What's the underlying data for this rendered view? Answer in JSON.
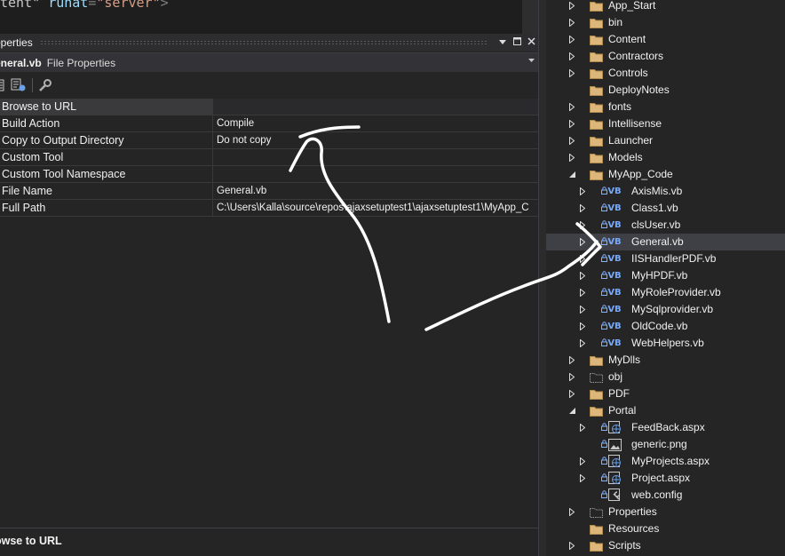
{
  "code_editor": {
    "line_parts": [
      "tent\"",
      " ",
      "runat",
      "=",
      "\"server\"",
      ">"
    ]
  },
  "properties": {
    "title": "operties",
    "object_name": "eneral.vb",
    "object_type": "File Properties",
    "rows": [
      {
        "name": "Browse to URL",
        "value": ""
      },
      {
        "name": "Build Action",
        "value": "Compile"
      },
      {
        "name": "Copy to Output Directory",
        "value": "Do not copy"
      },
      {
        "name": "Custom Tool",
        "value": ""
      },
      {
        "name": "Custom Tool Namespace",
        "value": ""
      },
      {
        "name": "File Name",
        "value": "General.vb"
      },
      {
        "name": "Full Path",
        "value": "C:\\Users\\Kalla\\source\\repos\\ajaxsetuptest1\\ajaxsetuptest1\\MyApp_C"
      }
    ],
    "description_title": "owse to URL"
  },
  "solution_explorer": {
    "items": [
      {
        "label": "App_Start",
        "level": 0,
        "icon": "folder-icon",
        "expander": "collapsed"
      },
      {
        "label": "bin",
        "level": 0,
        "icon": "folder-icon",
        "expander": "collapsed"
      },
      {
        "label": "Content",
        "level": 0,
        "icon": "folder-icon",
        "expander": "collapsed"
      },
      {
        "label": "Contractors",
        "level": 0,
        "icon": "folder-icon",
        "expander": "collapsed"
      },
      {
        "label": "Controls",
        "level": 0,
        "icon": "folder-icon",
        "expander": "collapsed"
      },
      {
        "label": "DeployNotes",
        "level": 0,
        "icon": "folder-icon",
        "expander": "none"
      },
      {
        "label": "fonts",
        "level": 0,
        "icon": "folder-icon",
        "expander": "collapsed"
      },
      {
        "label": "Intellisense",
        "level": 0,
        "icon": "folder-icon",
        "expander": "collapsed"
      },
      {
        "label": "Launcher",
        "level": 0,
        "icon": "folder-icon",
        "expander": "collapsed"
      },
      {
        "label": "Models",
        "level": 0,
        "icon": "folder-icon",
        "expander": "collapsed"
      },
      {
        "label": "MyApp_Code",
        "level": 0,
        "icon": "folder-icon",
        "expander": "expanded"
      },
      {
        "label": "AxisMis.vb",
        "level": 1,
        "icon": "vb-file-icon",
        "expander": "collapsed",
        "locked": true
      },
      {
        "label": "Class1.vb",
        "level": 1,
        "icon": "vb-file-icon",
        "expander": "collapsed",
        "locked": true
      },
      {
        "label": "clsUser.vb",
        "level": 1,
        "icon": "vb-file-icon",
        "expander": "collapsed",
        "locked": true
      },
      {
        "label": "General.vb",
        "level": 1,
        "icon": "vb-file-icon",
        "expander": "collapsed",
        "locked": true,
        "selected": true
      },
      {
        "label": "IISHandlerPDF.vb",
        "level": 1,
        "icon": "vb-file-icon",
        "expander": "collapsed",
        "locked": true
      },
      {
        "label": "MyHPDF.vb",
        "level": 1,
        "icon": "vb-file-icon",
        "expander": "collapsed",
        "locked": true
      },
      {
        "label": "MyRoleProvider.vb",
        "level": 1,
        "icon": "vb-file-icon",
        "expander": "collapsed",
        "locked": true
      },
      {
        "label": "MySqlprovider.vb",
        "level": 1,
        "icon": "vb-file-icon",
        "expander": "collapsed",
        "locked": true
      },
      {
        "label": "OldCode.vb",
        "level": 1,
        "icon": "vb-file-icon",
        "expander": "collapsed",
        "locked": true
      },
      {
        "label": "WebHelpers.vb",
        "level": 1,
        "icon": "vb-file-icon",
        "expander": "collapsed",
        "locked": true
      },
      {
        "label": "MyDlls",
        "level": 0,
        "icon": "folder-icon",
        "expander": "collapsed"
      },
      {
        "label": "obj",
        "level": 0,
        "icon": "folder-outline-icon",
        "expander": "collapsed"
      },
      {
        "label": "PDF",
        "level": 0,
        "icon": "folder-icon",
        "expander": "collapsed"
      },
      {
        "label": "Portal",
        "level": 0,
        "icon": "folder-icon",
        "expander": "expanded"
      },
      {
        "label": "FeedBack.aspx",
        "level": 1,
        "icon": "web-page-icon",
        "expander": "collapsed",
        "locked": true
      },
      {
        "label": "generic.png",
        "level": 1,
        "icon": "image-file-icon",
        "expander": "none",
        "locked": true
      },
      {
        "label": "MyProjects.aspx",
        "level": 1,
        "icon": "web-page-icon",
        "expander": "collapsed",
        "locked": true
      },
      {
        "label": "Project.aspx",
        "level": 1,
        "icon": "web-page-icon",
        "expander": "collapsed",
        "locked": true
      },
      {
        "label": "web.config",
        "level": 1,
        "icon": "config-file-icon",
        "expander": "none",
        "locked": true
      },
      {
        "label": "Properties",
        "level": 0,
        "icon": "folder-outline-icon",
        "expander": "collapsed"
      },
      {
        "label": "Resources",
        "level": 0,
        "icon": "folder-icon",
        "expander": "none"
      },
      {
        "label": "Scripts",
        "level": 0,
        "icon": "folder-icon",
        "expander": "collapsed"
      }
    ]
  },
  "colors": {
    "folder": "#dcb67a",
    "vb": "#74a9ff",
    "selected_row": "#3f3f46",
    "panel_bg": "#252526"
  }
}
